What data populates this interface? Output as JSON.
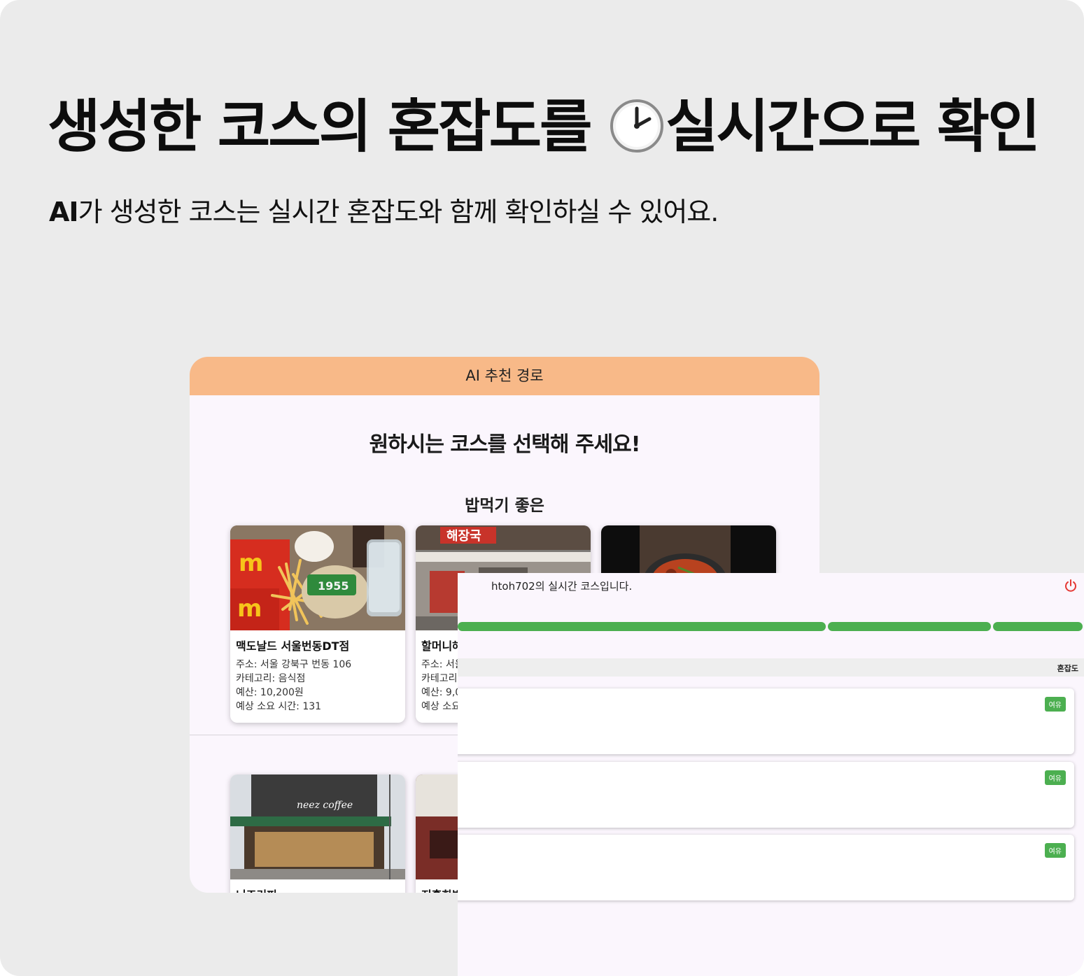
{
  "headline": {
    "before_icon": "생성한 코스의 혼잡도를 ",
    "icon": "clock-icon",
    "after_icon": "실시간으로 확인"
  },
  "subline": {
    "bold": "AI",
    "rest": "가 생성한 코스는 실시간 혼잡도와 함께 확인하실 수 있어요."
  },
  "screen1": {
    "header_title": "AI 추천 경로",
    "page_title": "원하시는 코스를 선택해 주세요!",
    "section_title": "밥먹기 좋은",
    "cards_row1": [
      {
        "name": "맥도날드 서울번동DT점",
        "address": "주소: 서울 강북구 번동 106",
        "category": "카테고리: 음식점",
        "budget": "예산: 10,200원",
        "duration": "예상 소요 시간: 131"
      },
      {
        "name": "할머니해",
        "address": "주소: 서울",
        "category": "카테고리:",
        "budget": "예산: 9,0",
        "duration": "예상 소요"
      },
      {}
    ],
    "cards_row2": [
      {
        "name": "니즈커피"
      },
      {
        "name": "지혼한밥"
      }
    ],
    "photo_signs": {
      "haejangguk": "해장국",
      "coffee": "neez coffee",
      "burger_box": "1955"
    }
  },
  "screen2": {
    "title": "htoh702의 실시간 코스입니다.",
    "column_header": "혼잡도",
    "progress": [
      1,
      1,
      1
    ],
    "rows": [
      {
        "badge": "여유"
      },
      {
        "badge": "여유"
      },
      {
        "badge": "여유"
      }
    ],
    "accent": "#4caf50",
    "power_color": "#e53935"
  }
}
